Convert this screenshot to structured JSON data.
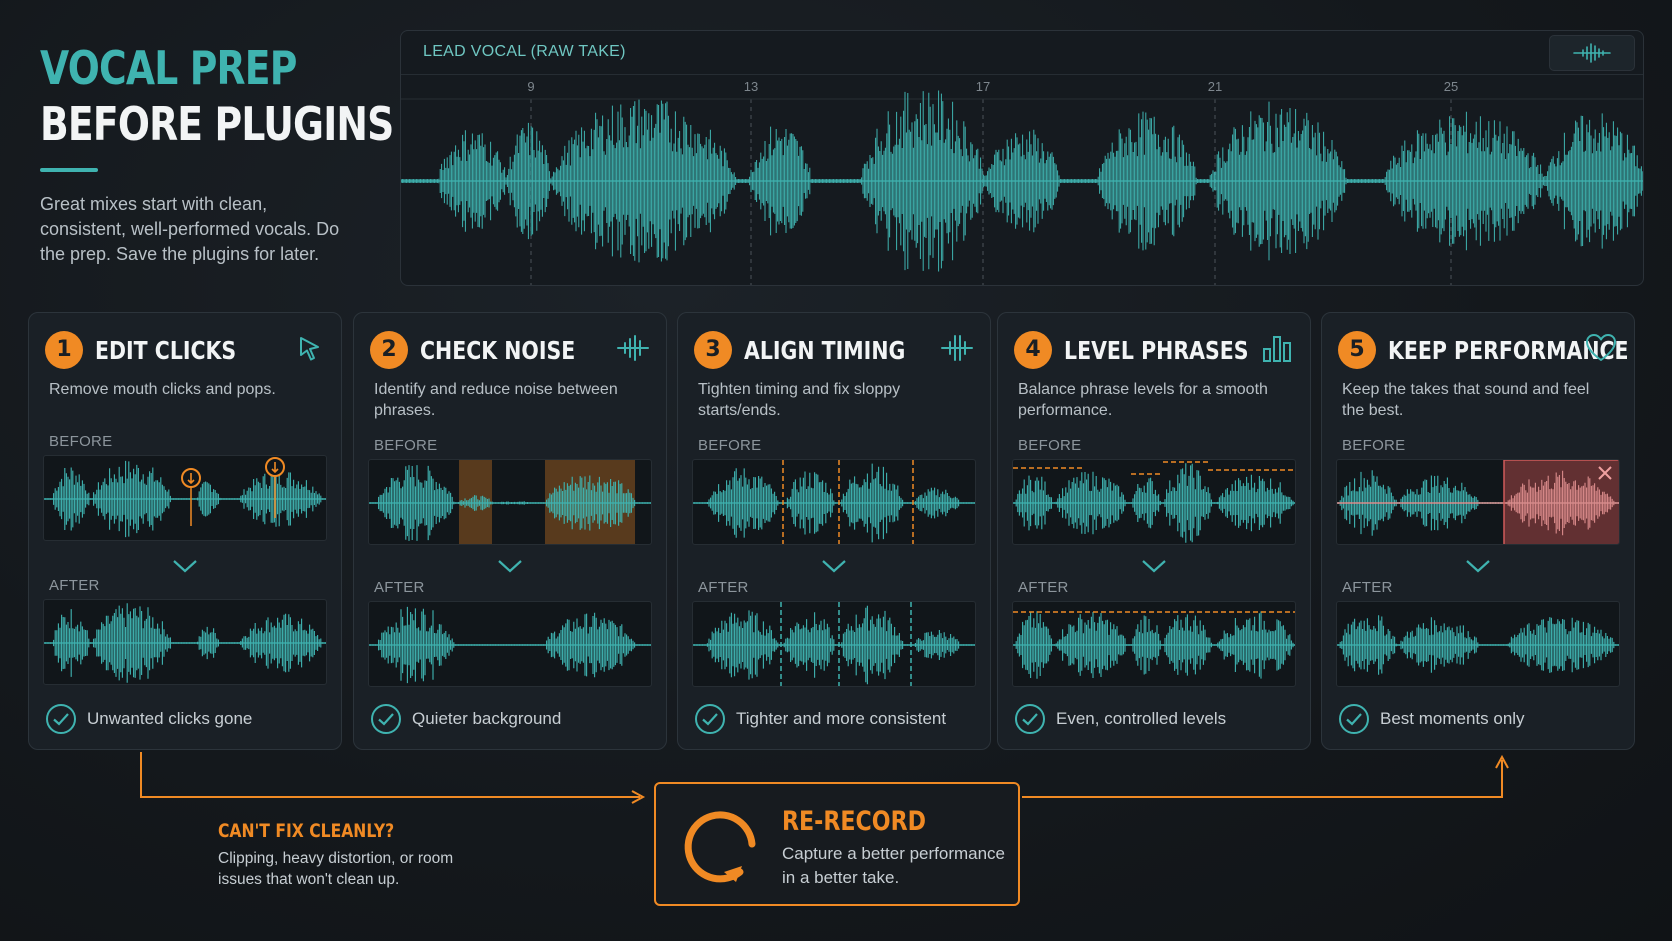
{
  "title": {
    "line1": "VOCAL PREP",
    "line2": "BEFORE PLUGINS"
  },
  "intro": "Great mixes start with clean, consistent, well-performed vocals. Do the prep. Save the plugins for later.",
  "track": {
    "title": "LEAD VOCAL (RAW TAKE)",
    "bar_markers": [
      "9",
      "13",
      "17",
      "21",
      "25"
    ]
  },
  "labels": {
    "before": "BEFORE",
    "after": "AFTER"
  },
  "steps": [
    {
      "number": "1",
      "title": "EDIT CLICKS",
      "description": "Remove mouth clicks and pops.",
      "icon": "cursor-icon",
      "result": "Unwanted clicks gone"
    },
    {
      "number": "2",
      "title": "CHECK NOISE",
      "description": "Identify and reduce noise between phrases.",
      "icon": "waveform-icon",
      "result": "Quieter background"
    },
    {
      "number": "3",
      "title": "ALIGN TIMING",
      "description": "Tighten timing and fix sloppy starts/ends.",
      "icon": "timing-align-icon",
      "result": "Tighter and more consistent"
    },
    {
      "number": "4",
      "title": "LEVEL PHRASES",
      "description": "Balance phrase levels for a smooth performance.",
      "icon": "level-bars-icon",
      "result": "Even, controlled levels"
    },
    {
      "number": "5",
      "title": "KEEP PERFORMANCE",
      "description": "Keep the takes that sound and feel the best.",
      "icon": "heart-icon",
      "result": "Best moments only"
    }
  ],
  "fallback": {
    "title": "CAN'T FIX CLEANLY?",
    "description": "Clipping, heavy distortion, or room issues that won't clean up."
  },
  "rerecord": {
    "title": "RE-RECORD",
    "description": "Capture a better performance in a better take."
  },
  "colors": {
    "teal": "#3fb3b0",
    "orange": "#f08a24",
    "reject": "#c96060",
    "background": "#14181c"
  }
}
